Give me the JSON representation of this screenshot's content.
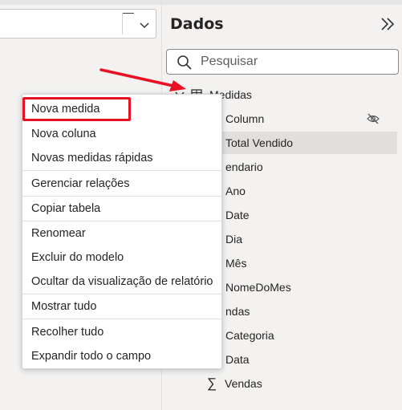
{
  "panel": {
    "title": "Dados",
    "search_placeholder": "Pesquisar"
  },
  "tree": {
    "table_name": "Medidas",
    "rows": [
      {
        "label": "Column",
        "hidden_icon": "eye-off-icon"
      },
      {
        "label": "Total Vendido",
        "selected": true
      },
      {
        "label": "endario"
      },
      {
        "label": "Ano"
      },
      {
        "label": "Date"
      },
      {
        "label": "Dia"
      },
      {
        "label": "Mês"
      },
      {
        "label": "NomeDoMes"
      },
      {
        "label": "ndas"
      },
      {
        "label": "Categoria"
      },
      {
        "label": "Data"
      },
      {
        "label": "Vendas",
        "icon": "sigma-icon",
        "symbol": "∑"
      }
    ]
  },
  "menu": {
    "items": [
      {
        "label": "Nova medida",
        "highlighted": true
      },
      {
        "label": "Nova coluna"
      },
      {
        "label": "Novas medidas rápidas"
      },
      {
        "label": "Gerenciar relações"
      },
      {
        "label": "Copiar tabela"
      },
      {
        "label": "Renomear"
      },
      {
        "label": "Excluir do modelo"
      },
      {
        "label": "Ocultar da visualização de relatório"
      },
      {
        "label": "Mostrar tudo"
      },
      {
        "label": "Recolher tudo"
      },
      {
        "label": "Expandir todo o campo"
      }
    ]
  },
  "colors": {
    "highlight": "#e81123",
    "arrow": "#e81123",
    "pane_bg": "#f3f2f1",
    "selected_row": "#e1dfdd"
  }
}
